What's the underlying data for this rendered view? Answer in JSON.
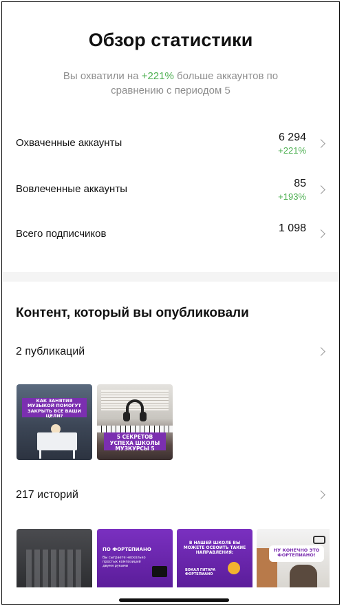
{
  "overview": {
    "title": "Обзор статистики",
    "subtitle_before": "Вы охватили на ",
    "subtitle_highlight": "+221%",
    "subtitle_after": " больше аккаунтов по сравнению с периодом 5"
  },
  "stats": [
    {
      "label": "Охваченные аккаунты",
      "value": "6 294",
      "delta": "+221%"
    },
    {
      "label": "Вовлеченные аккаунты",
      "value": "85",
      "delta": "+193%"
    },
    {
      "label": "Всего подписчиков",
      "value": "1 098",
      "delta": ""
    }
  ],
  "content": {
    "title": "Контент, который вы опубликовали",
    "posts_label": "2 публикаций",
    "stories_label": "217 историй",
    "posts": [
      {
        "caption": "КАК ЗАНЯТИЯ МУЗЫКОЙ ПОМОГУТ ЗАКРЫТЬ ВСЕ ВАШИ ЦЕЛИ?"
      },
      {
        "caption": "5 СЕКРЕТОВ УСПЕХА ШКОЛЫ МУЗКУРСЫ 5"
      }
    ],
    "stories": [
      {
        "caption": ""
      },
      {
        "caption": "ПО ФОРТЕПИАНО",
        "sub": "Вы сыграете несколько простых композиций двумя руками"
      },
      {
        "caption": "В НАШЕЙ ШКОЛЕ ВЫ МОЖЕТЕ ОСВОИТЬ ТАКИЕ НАПРАВЛЕНИЯ:",
        "sub": "ВОКАЛ ГИТАРА ФОРТЕПИАНО"
      },
      {
        "caption": "НУ КОНЕЧНО ЭТО ФОРТЕПИАНО!"
      }
    ]
  },
  "colors": {
    "positive": "#4caf50",
    "secondary_text": "#8e8e8e",
    "story_purple": "#6a1fa0"
  },
  "icons": [
    "chevron-right-icon",
    "headphones-icon"
  ]
}
